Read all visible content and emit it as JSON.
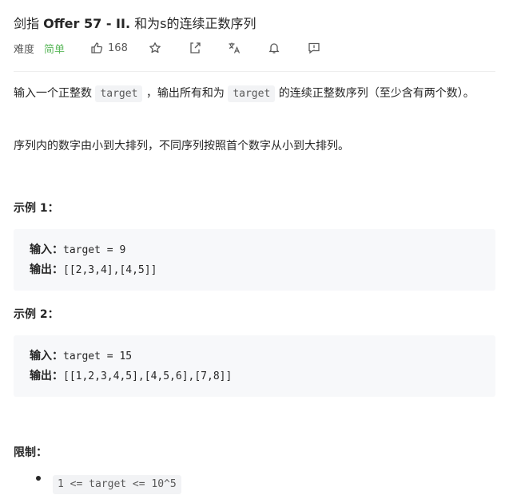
{
  "header": {
    "title_prefix": "剑指",
    "title_bold": "Offer 57 - II.",
    "title_suffix": "和为s的连续正数序列",
    "difficulty_label": "难度",
    "difficulty_value": "简单",
    "likes": "168",
    "icons": [
      "thumbs-up-icon",
      "star-icon",
      "share-icon",
      "translate-icon",
      "bell-icon",
      "feedback-icon"
    ]
  },
  "description": {
    "p1_a": "输入一个正整数",
    "p1_code1": "target",
    "p1_b": "，输出所有和为",
    "p1_code2": "target",
    "p1_c": "的连续正整数序列（至少含有两个数）。",
    "p2": "序列内的数字由小到大排列，不同序列按照首个数字从小到大排列。"
  },
  "examples": [
    {
      "title": "示例 1：",
      "input_label": "输入：",
      "input_value": "target = 9",
      "output_label": "输出：",
      "output_value": "[[2,3,4],[4,5]]"
    },
    {
      "title": "示例 2：",
      "input_label": "输入：",
      "input_value": "target = 15",
      "output_label": "输出：",
      "output_value": "[[1,2,3,4,5],[4,5,6],[7,8]]"
    }
  ],
  "constraints": {
    "title": "限制：",
    "items": [
      "1 <= target <= 10^5"
    ]
  },
  "colors": {
    "difficulty_easy": "#5cb85c",
    "code_bg": "#f2f3f5",
    "pre_bg": "#f7f8fa"
  }
}
